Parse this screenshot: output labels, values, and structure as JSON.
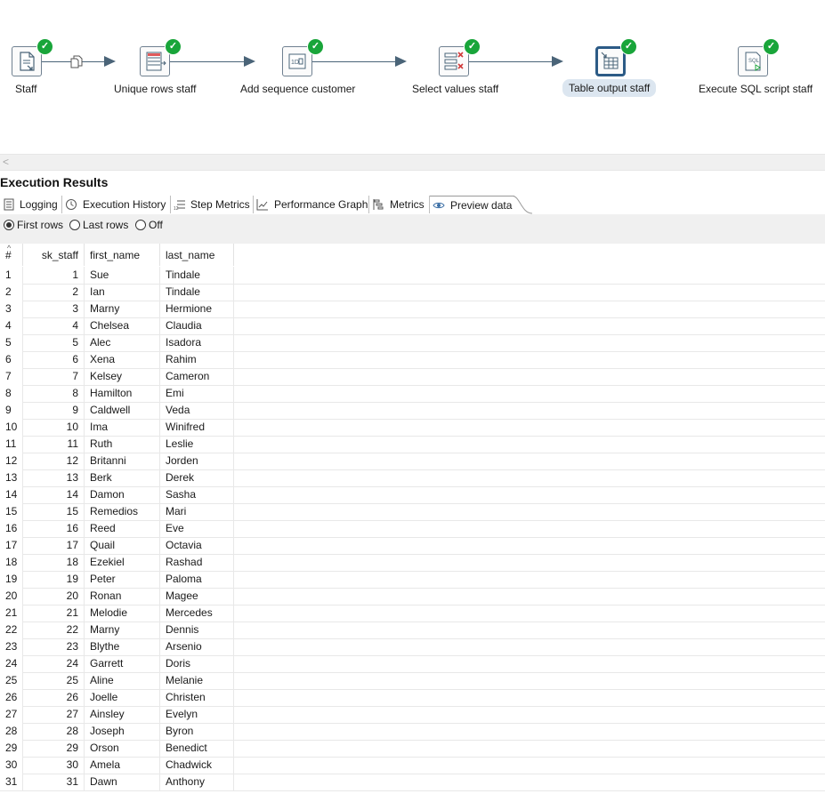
{
  "canvas": {
    "steps": [
      {
        "name": "staff",
        "label": "Staff",
        "icon": "text-file-input-icon",
        "status": "success"
      },
      {
        "name": "unique-rows-staff",
        "label": "Unique rows staff",
        "icon": "unique-rows-icon",
        "status": "success"
      },
      {
        "name": "add-sequence-customer",
        "label": "Add sequence customer",
        "icon": "add-sequence-icon",
        "status": "success"
      },
      {
        "name": "select-values-staff",
        "label": "Select values staff",
        "icon": "select-values-icon",
        "status": "success"
      },
      {
        "name": "table-output-staff",
        "label": "Table output staff",
        "icon": "table-output-icon",
        "status": "success",
        "selected": true
      },
      {
        "name": "execute-sql-script-staff",
        "label": "Execute SQL script staff",
        "icon": "sql-script-icon",
        "status": "success"
      }
    ],
    "status_icon": "check-icon",
    "hop_color": "#4a6478",
    "success_color": "#19a53a"
  },
  "results": {
    "title": "Execution Results",
    "tabs": [
      {
        "label": "Logging",
        "icon": "logging-icon"
      },
      {
        "label": "Execution History",
        "icon": "history-icon"
      },
      {
        "label": "Step Metrics",
        "icon": "step-metrics-icon"
      },
      {
        "label": "Performance Graph",
        "icon": "performance-graph-icon"
      },
      {
        "label": "Metrics",
        "icon": "metrics-icon"
      },
      {
        "label": "Preview data",
        "icon": "eye-icon",
        "active": true
      }
    ],
    "filter": {
      "options": [
        "First rows",
        "Last rows",
        "Off"
      ],
      "selected": "First rows"
    }
  },
  "table": {
    "columns": [
      "#",
      "sk_staff",
      "first_name",
      "last_name"
    ],
    "rows": [
      [
        "1",
        "1",
        "Sue",
        "Tindale"
      ],
      [
        "2",
        "2",
        "Ian",
        "Tindale"
      ],
      [
        "3",
        "3",
        "Marny",
        "Hermione"
      ],
      [
        "4",
        "4",
        "Chelsea",
        "Claudia"
      ],
      [
        "5",
        "5",
        "Alec",
        "Isadora"
      ],
      [
        "6",
        "6",
        "Xena",
        "Rahim"
      ],
      [
        "7",
        "7",
        "Kelsey",
        "Cameron"
      ],
      [
        "8",
        "8",
        "Hamilton",
        "Emi"
      ],
      [
        "9",
        "9",
        "Caldwell",
        "Veda"
      ],
      [
        "10",
        "10",
        "Ima",
        "Winifred"
      ],
      [
        "11",
        "11",
        "Ruth",
        "Leslie"
      ],
      [
        "12",
        "12",
        "Britanni",
        "Jorden"
      ],
      [
        "13",
        "13",
        "Berk",
        "Derek"
      ],
      [
        "14",
        "14",
        "Damon",
        "Sasha"
      ],
      [
        "15",
        "15",
        "Remedios",
        "Mari"
      ],
      [
        "16",
        "16",
        "Reed",
        "Eve"
      ],
      [
        "17",
        "17",
        "Quail",
        "Octavia"
      ],
      [
        "18",
        "18",
        "Ezekiel",
        "Rashad"
      ],
      [
        "19",
        "19",
        "Peter",
        "Paloma"
      ],
      [
        "20",
        "20",
        "Ronan",
        "Magee"
      ],
      [
        "21",
        "21",
        "Melodie",
        "Mercedes"
      ],
      [
        "22",
        "22",
        "Marny",
        "Dennis"
      ],
      [
        "23",
        "23",
        "Blythe",
        "Arsenio"
      ],
      [
        "24",
        "24",
        "Garrett",
        "Doris"
      ],
      [
        "25",
        "25",
        "Aline",
        "Melanie"
      ],
      [
        "26",
        "26",
        "Joelle",
        "Christen"
      ],
      [
        "27",
        "27",
        "Ainsley",
        "Evelyn"
      ],
      [
        "28",
        "28",
        "Joseph",
        "Byron"
      ],
      [
        "29",
        "29",
        "Orson",
        "Benedict"
      ],
      [
        "30",
        "30",
        "Amela",
        "Chadwick"
      ],
      [
        "31",
        "31",
        "Dawn",
        "Anthony"
      ]
    ]
  }
}
